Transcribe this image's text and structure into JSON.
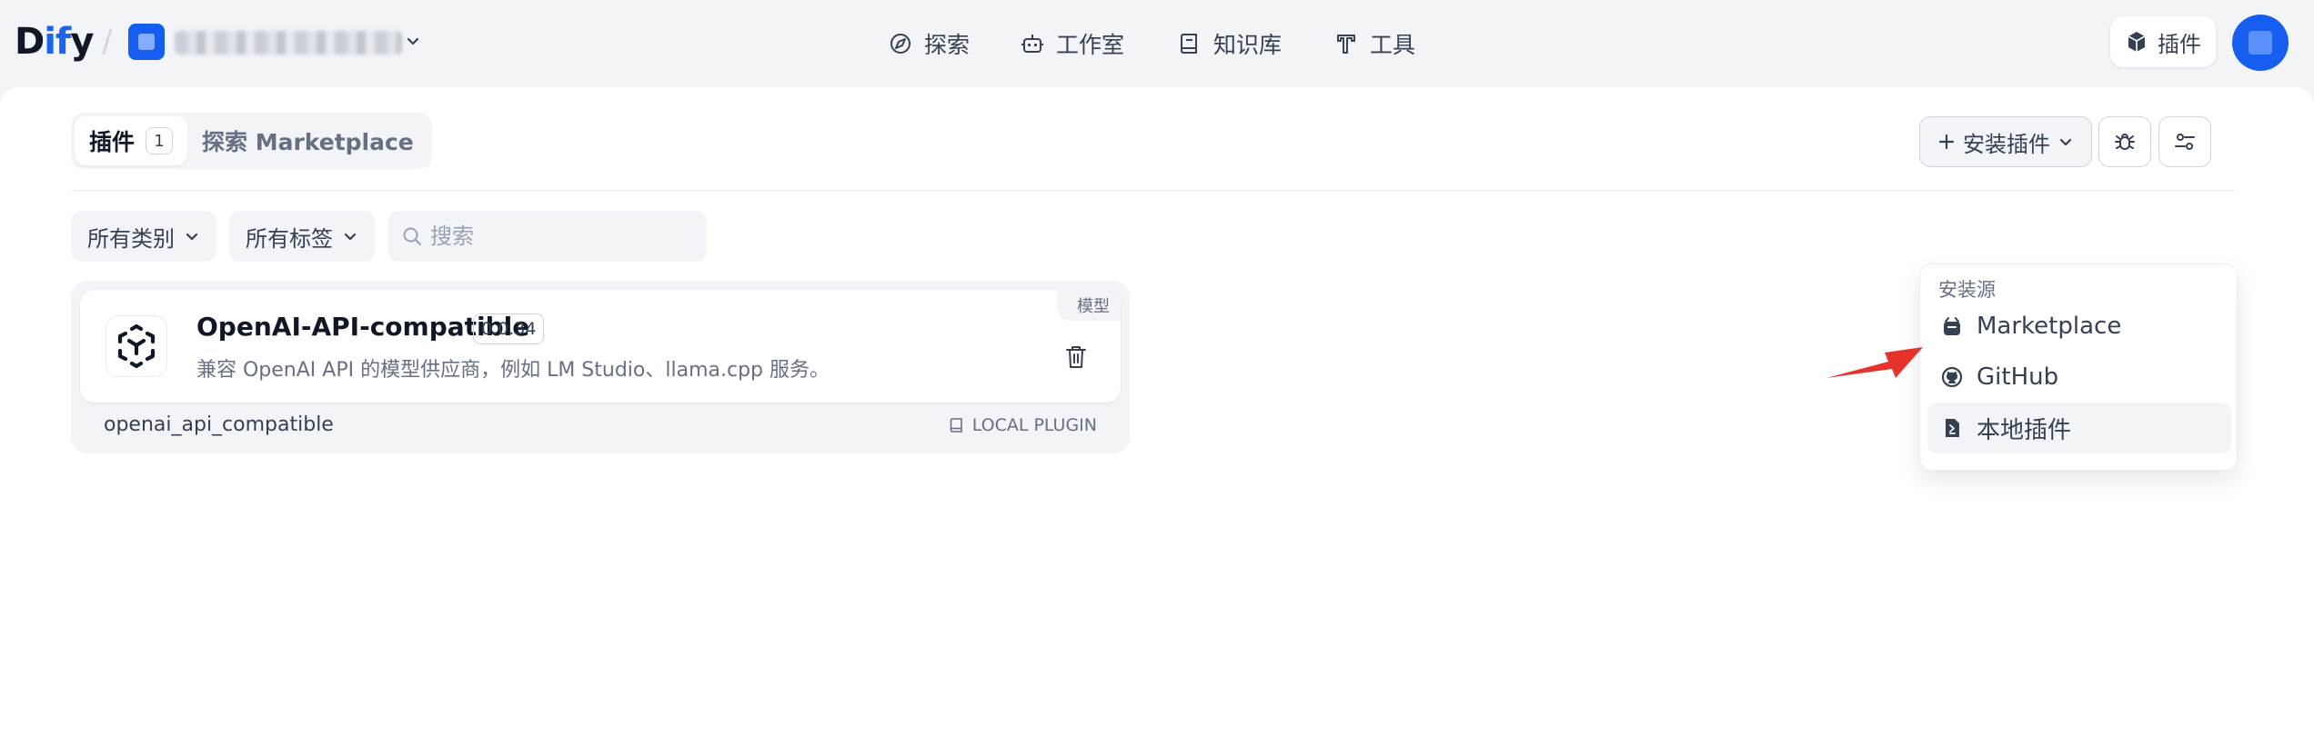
{
  "brand": {
    "logo_prefix": "D",
    "logo_highlight": "if",
    "logo_suffix": "y",
    "accent": "#1c64f2"
  },
  "nav": [
    {
      "label": "探索",
      "icon": "compass-icon"
    },
    {
      "label": "工作室",
      "icon": "robot-icon"
    },
    {
      "label": "知识库",
      "icon": "book-icon"
    },
    {
      "label": "工具",
      "icon": "hammer-icon"
    }
  ],
  "header": {
    "plugins_label": "插件"
  },
  "tabs": {
    "plugins_label": "插件",
    "plugins_count": "1",
    "marketplace_label": "探索 Marketplace"
  },
  "toolbar": {
    "install_label": "安装插件"
  },
  "filters": {
    "category": "所有类别",
    "tags": "所有标签",
    "search_placeholder": "搜索"
  },
  "plugin": {
    "name": "OpenAI-API-compatible",
    "version": "0.0.34",
    "category_badge": "模型",
    "description": "兼容 OpenAI API 的模型供应商，例如 LM Studio、llama.cpp 服务。",
    "id": "openai_api_compatible",
    "source": "LOCAL PLUGIN"
  },
  "install_menu": {
    "heading": "安装源",
    "items": [
      {
        "label": "Marketplace",
        "icon": "marketplace-icon"
      },
      {
        "label": "GitHub",
        "icon": "github-icon"
      },
      {
        "label": "本地插件",
        "icon": "local-file-icon"
      }
    ]
  },
  "colors": {
    "annotation_arrow": "#e5322d",
    "primary": "#155eef"
  }
}
